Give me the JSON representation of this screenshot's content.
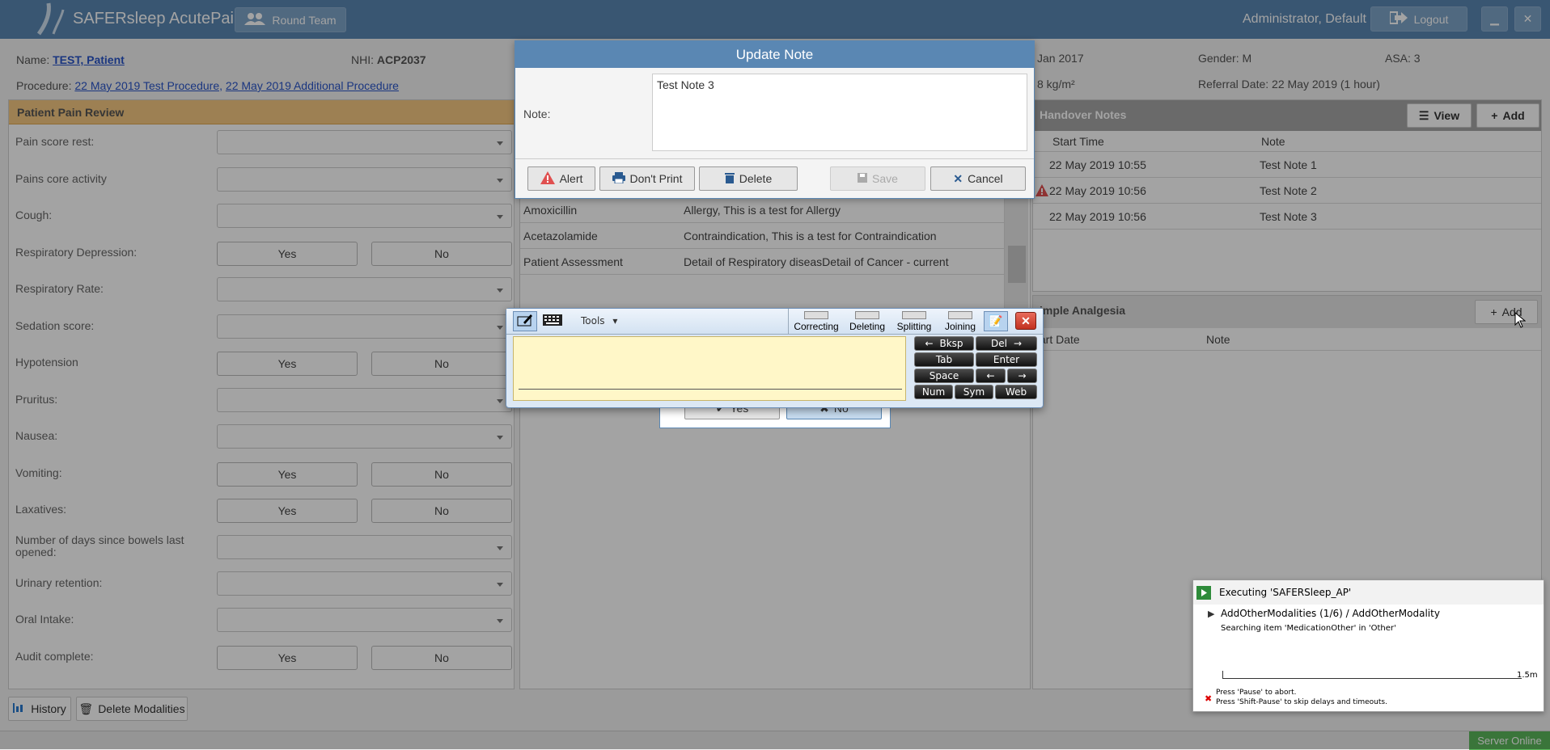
{
  "header": {
    "app_title": "SAFERsleep AcutePain",
    "round_team": "Round Team",
    "user": "Administrator, Default",
    "logout": "Logout",
    "minimize": "▁",
    "close": "✕"
  },
  "patient": {
    "name_label": "Name:",
    "name_value": "TEST, Patient",
    "nhi_label": "NHI:",
    "nhi_value": "ACP2037",
    "dob_partial": "Jan 2017",
    "gender": "Gender: M",
    "asa": "ASA: 3",
    "procedure_label": "Procedure:",
    "procedure_1": "22 May 2019 Test Procedure,",
    "procedure_2": "22 May 2019 Additional Procedure",
    "bmi_partial": "8 kg/m²",
    "referral": "Referral Date: 22 May 2019 (1 hour)"
  },
  "pain_review": {
    "title": "Patient Pain Review",
    "yes": "Yes",
    "no": "No",
    "rows": [
      {
        "label": "Pain score rest:"
      },
      {
        "label": "Pains core activity"
      },
      {
        "label": "Cough:"
      },
      {
        "label": "Respiratory Depression:"
      },
      {
        "label": "Respiratory Rate:"
      },
      {
        "label": "Sedation score:"
      },
      {
        "label": "Hypotension"
      },
      {
        "label": "Pruritus:"
      },
      {
        "label": "Nausea:"
      },
      {
        "label": "Vomiting:"
      },
      {
        "label": "Laxatives:"
      },
      {
        "label": "Number of days since bowels last opened:"
      },
      {
        "label": "Urinary retention:"
      },
      {
        "label": "Oral Intake:"
      },
      {
        "label": "Audit complete:"
      }
    ]
  },
  "alerts_table": {
    "rows": [
      {
        "name": "Amoxicillin",
        "detail": "Allergy, This is a test for Allergy"
      },
      {
        "name": "Acetazolamide",
        "detail": "Contraindication, This is a test for Contraindication"
      },
      {
        "name": "Patient Assessment",
        "detail": "Detail of Respiratory diseasDetail of Cancer - current"
      }
    ]
  },
  "handover": {
    "title": "Handover Notes",
    "view": "View",
    "add": "Add",
    "col_start": "Start Time",
    "col_note": "Note",
    "rows": [
      {
        "time": "22 May 2019 10:55",
        "note": "Test Note 1"
      },
      {
        "time": "22 May 2019 10:56",
        "note": "Test Note 2"
      },
      {
        "time": "22 May 2019 10:56",
        "note": "Test Note 3"
      }
    ]
  },
  "simple_analgesia": {
    "title": "imple Analgesia",
    "add": "Add",
    "col_start": "tart Date",
    "col_note": "Note"
  },
  "footer": {
    "history": "History",
    "delete_modalities": "Delete Modalities",
    "status": "Server Online"
  },
  "confirm_dialog": {
    "yes": "Yes",
    "no": "No"
  },
  "update_note": {
    "title": "Update Note",
    "note_label": "Note:",
    "note_value": "Test Note 3",
    "alert": "Alert",
    "dont_print": "Don't Print",
    "delete": "Delete",
    "save": "Save",
    "cancel": "Cancel"
  },
  "tip": {
    "tools": "Tools",
    "correcting": "Correcting",
    "deleting": "Deleting",
    "splitting": "Splitting",
    "joining": "Joining",
    "bksp": "Bksp",
    "del": "Del",
    "tab": "Tab",
    "enter": "Enter",
    "space": "Space",
    "num": "Num",
    "sym": "Sym",
    "web": "Web"
  },
  "exec_popup": {
    "title": "Executing 'SAFERSleep_AP'",
    "step": "AddOtherModalities (1/6) / AddOtherModality",
    "detail": "Searching item 'MedicationOther' in 'Other'",
    "time": "1.5m",
    "hint1": "Press 'Pause' to abort.",
    "hint2": "Press 'Shift-Pause' to skip delays and timeouts."
  },
  "colors": {
    "header": "#5a87b3",
    "dialog_title": "#5a87b3",
    "orange_header": "#f6c982",
    "tip_yellow": "#fff7c8"
  }
}
